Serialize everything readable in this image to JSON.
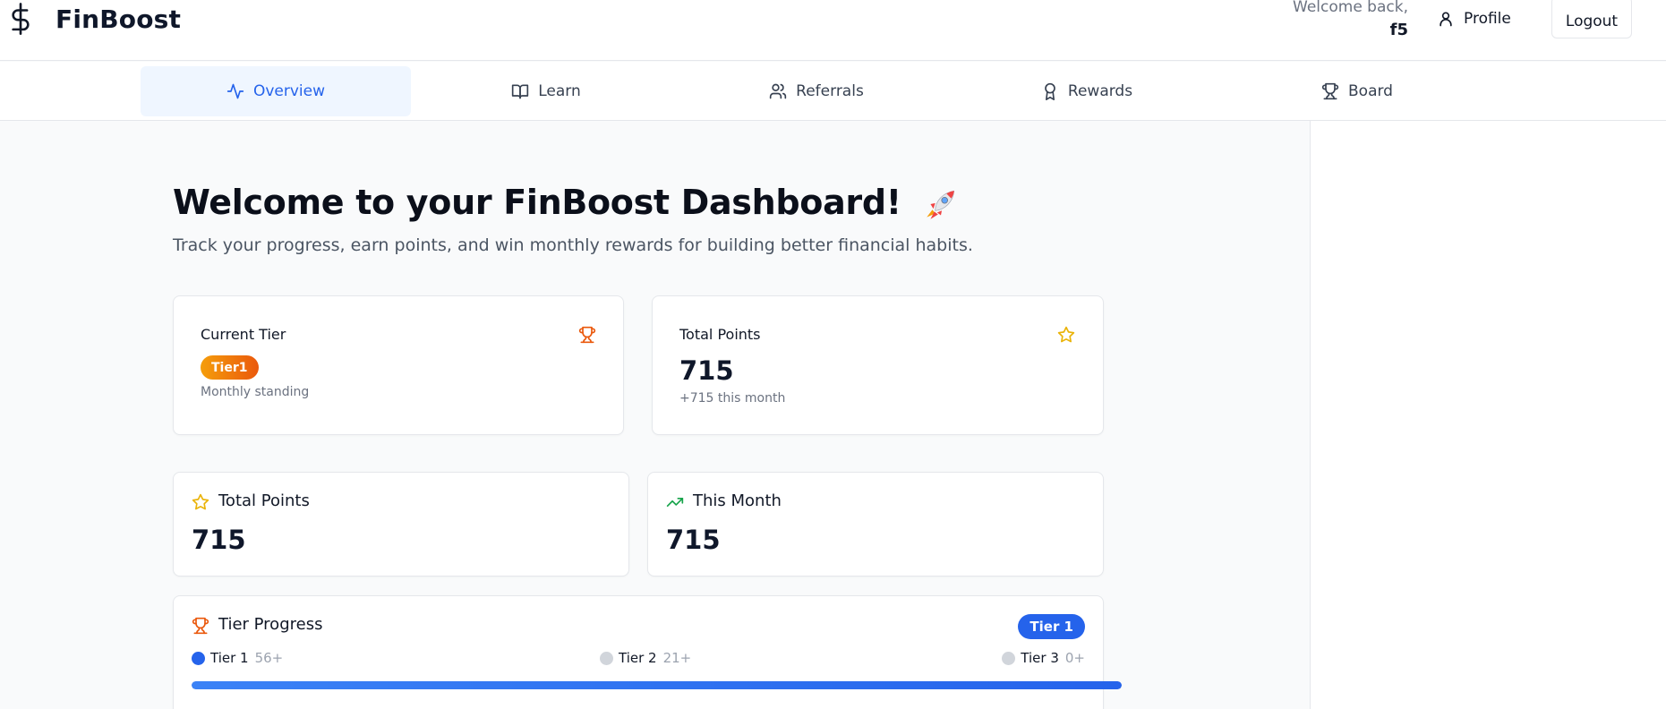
{
  "header": {
    "brand": "FinBoost",
    "welcome_line": "Welcome back,",
    "username": "f5",
    "profile_label": "Profile",
    "logout_label": "Logout"
  },
  "tabs": [
    {
      "label": "Overview",
      "icon": "activity-icon",
      "active": true
    },
    {
      "label": "Learn",
      "icon": "book-open-icon",
      "active": false
    },
    {
      "label": "Referrals",
      "icon": "users-icon",
      "active": false
    },
    {
      "label": "Rewards",
      "icon": "award-icon",
      "active": false
    },
    {
      "label": "Board",
      "icon": "trophy-icon",
      "active": false
    }
  ],
  "main": {
    "title": "Welcome to your FinBoost Dashboard!",
    "title_emoji": "rocket-icon",
    "subtitle": "Track your progress, earn points, and win monthly rewards for building better financial habits."
  },
  "current_tier_card": {
    "title": "Current Tier",
    "badge": "Tier1",
    "caption": "Monthly standing",
    "icon": "trophy-icon"
  },
  "total_points_card": {
    "title": "Total Points",
    "value": "715",
    "caption": "+715 this month",
    "icon": "star-icon"
  },
  "stats": {
    "total_points": {
      "label": "Total Points",
      "value": "715",
      "icon": "star-icon"
    },
    "this_month": {
      "label": "This Month",
      "value": "715",
      "icon": "trending-up-icon"
    }
  },
  "tier_progress": {
    "title": "Tier Progress",
    "current_badge": "Tier 1",
    "tiers": [
      {
        "name": "Tier 1",
        "requirement": "56+",
        "reached": true
      },
      {
        "name": "Tier 2",
        "requirement": "21+",
        "reached": false
      },
      {
        "name": "Tier 3",
        "requirement": "0+",
        "reached": false
      }
    ],
    "progress_fraction": 1.0
  },
  "colors": {
    "accent": "#2563eb",
    "tier_badge": "#ea580c",
    "star": "#eab308",
    "trend": "#16a34a"
  }
}
